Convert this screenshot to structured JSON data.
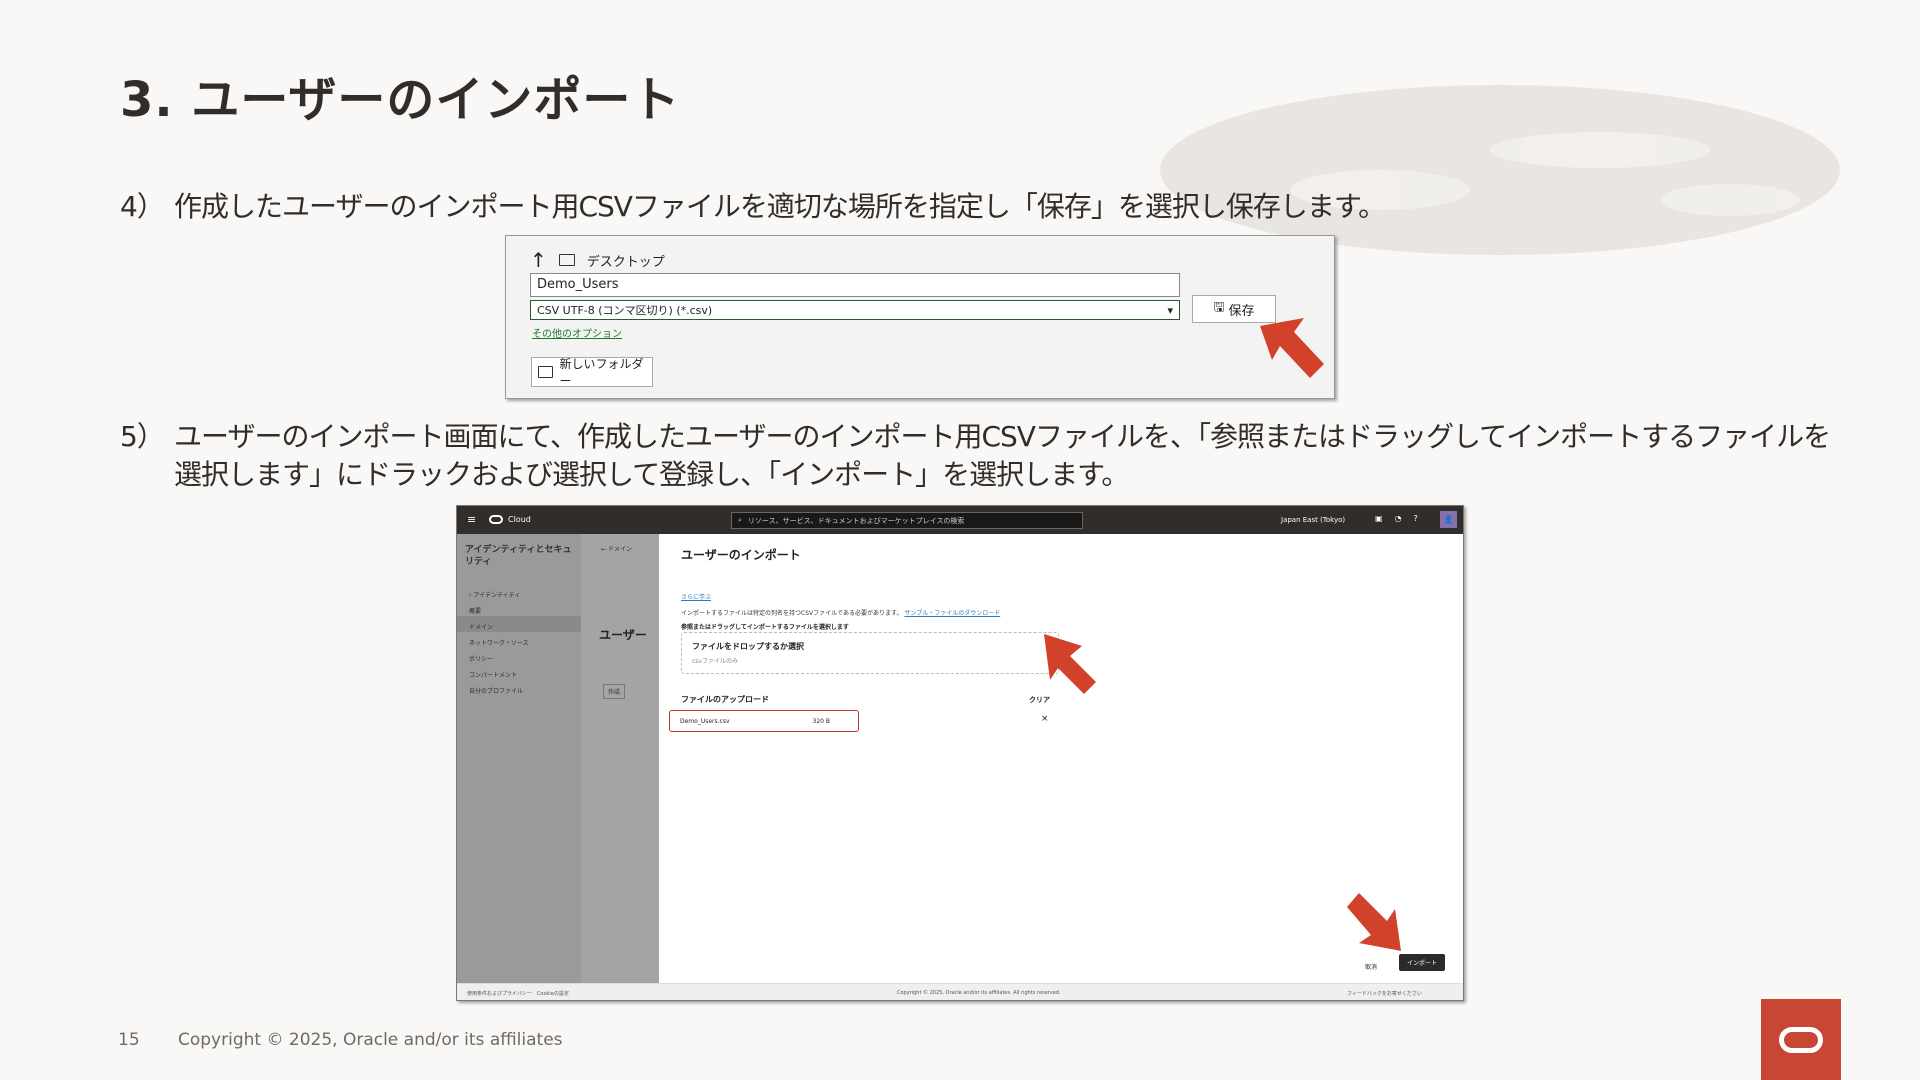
{
  "slide": {
    "title": "3. ユーザーのインポート",
    "step4_num": "4）",
    "step4_text": "作成したユーザーのインポート用CSVファイルを適切な場所を指定し「保存」を選択し保存します。",
    "step5_num": "5）",
    "step5_line1": "ユーザーのインポート画面にて、作成したユーザーのインポート用CSVファイルを、「参照またはドラッグしてインポートするファイルを",
    "step5_line2": "選択します」にドラックおよび選択して登録し、「インポート」を選択します。"
  },
  "save_dialog": {
    "location": "デスクトップ",
    "filename": "Demo_Users",
    "filetype": "CSV UTF-8 (コンマ区切り) (*.csv)",
    "other_options": "その他のオプション",
    "new_folder": "新しいフォルダー",
    "save_button": "保存"
  },
  "oci": {
    "brand": "Cloud",
    "search_placeholder": "リソース、サービス、ドキュメントおよびマーケットプレイスの検索",
    "region": "Japan East (Tokyo)",
    "sidebar_title": "アイデンティティとセキュリティ",
    "sidebar_back": "アイデンティティ",
    "sidebar_items": [
      "概要",
      "ドメイン",
      "ネットワーク・ソース",
      "ポリシー",
      "コンパートメント",
      "自分のプロファイル"
    ],
    "mid_back": "ドメイン",
    "mid_title": "ユーザー",
    "mid_create": "作成",
    "panel_title": "ユーザーのインポート",
    "learn_more": "さらに学ぶ",
    "description": "インポートするファイルは特定の列名を持つCSVファイルである必要があります。",
    "sample_link": "サンプル・ファイルのダウンロード",
    "browse_label": "参照またはドラッグしてインポートするファイルを選択します",
    "dropzone_title": "ファイルをドロップするか選択",
    "dropzone_sub": "csvファイルのみ",
    "upload_label": "ファイルのアップロード",
    "clear": "クリア",
    "file_name": "Demo_Users.csv",
    "file_size": "320 B",
    "cancel": "取消",
    "import": "インポート",
    "footer_left": "使用条件およびプライバシー　Cookieの設定",
    "footer_center": "Copyright © 2025, Oracle and/or its affiliates. All rights reserved.",
    "footer_right": "フィードバックをお寄せください"
  },
  "footer": {
    "page_number": "15",
    "copyright": "Copyright © 2025, Oracle and/or its affiliates"
  },
  "colors": {
    "oracle_red": "#c74634",
    "arrow_red": "#d2412a",
    "text_dark": "#312d2a"
  }
}
